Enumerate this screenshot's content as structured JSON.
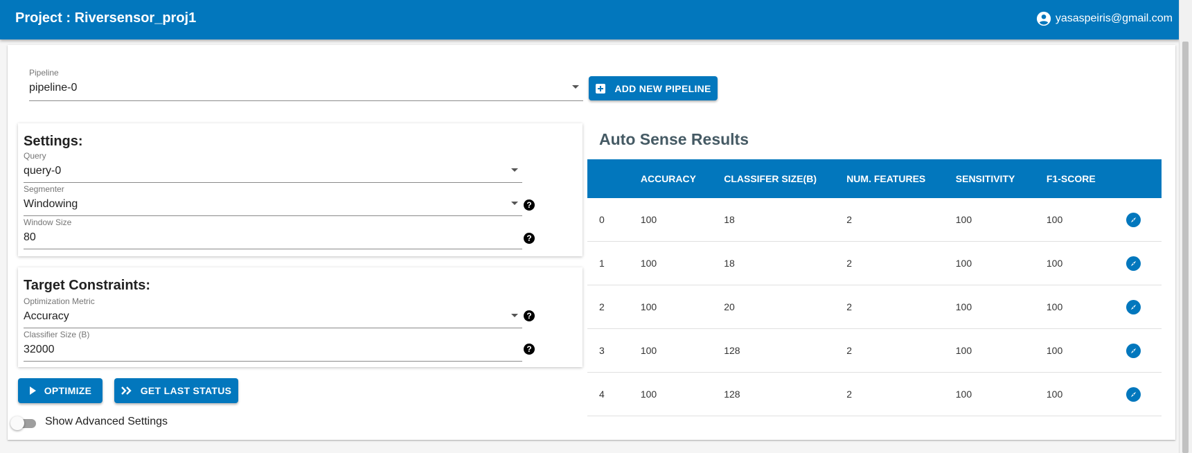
{
  "header": {
    "title": "Project : Riversensor_proj1",
    "user": "yasaspeiris@gmail.com"
  },
  "pipeline": {
    "label": "Pipeline",
    "value": "pipeline-0",
    "add_button": "ADD NEW PIPELINE"
  },
  "settings": {
    "title": "Settings:",
    "query": {
      "label": "Query",
      "value": "query-0"
    },
    "segmenter": {
      "label": "Segmenter",
      "value": "Windowing"
    },
    "window_size": {
      "label": "Window Size",
      "value": "80"
    }
  },
  "constraints": {
    "title": "Target Constraints:",
    "metric": {
      "label": "Optimization Metric",
      "value": "Accuracy"
    },
    "classifier_size": {
      "label": "Classifier Size (B)",
      "value": "32000"
    }
  },
  "actions": {
    "optimize": "OPTIMIZE",
    "last_status": "GET LAST STATUS"
  },
  "advanced": {
    "label": "Show Advanced Settings",
    "enabled": false
  },
  "results": {
    "title": "Auto Sense Results",
    "columns": [
      "",
      "ACCURACY",
      "CLASSIFER SIZE(B)",
      "NUM. FEATURES",
      "SENSITIVITY",
      "F1-SCORE",
      ""
    ],
    "rows": [
      {
        "index": "0",
        "accuracy": "100",
        "size": "18",
        "features": "2",
        "sensitivity": "100",
        "f1": "100"
      },
      {
        "index": "1",
        "accuracy": "100",
        "size": "18",
        "features": "2",
        "sensitivity": "100",
        "f1": "100"
      },
      {
        "index": "2",
        "accuracy": "100",
        "size": "20",
        "features": "2",
        "sensitivity": "100",
        "f1": "100"
      },
      {
        "index": "3",
        "accuracy": "100",
        "size": "128",
        "features": "2",
        "sensitivity": "100",
        "f1": "100"
      },
      {
        "index": "4",
        "accuracy": "100",
        "size": "128",
        "features": "2",
        "sensitivity": "100",
        "f1": "100"
      }
    ]
  },
  "icons": {
    "user": "account-circle-icon",
    "add": "add-box-icon",
    "play": "play-arrow-icon",
    "fast_forward": "double-chevron-icon",
    "help": "help-circle-icon",
    "explore": "compass-icon"
  },
  "colors": {
    "primary": "#0277bd",
    "results_title": "#455a64"
  }
}
